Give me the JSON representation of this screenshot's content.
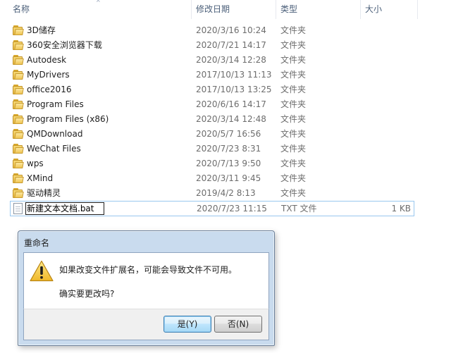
{
  "columns": {
    "name": "名称",
    "date": "修改日期",
    "type": "类型",
    "size": "大小"
  },
  "rows": [
    {
      "name": "3D储存",
      "date": "2020/3/16 10:24",
      "type": "文件夹",
      "size": "",
      "icon": "folder-icon"
    },
    {
      "name": "360安全浏览器下载",
      "date": "2020/7/21 14:17",
      "type": "文件夹",
      "size": "",
      "icon": "folder-icon"
    },
    {
      "name": "Autodesk",
      "date": "2020/3/14 12:28",
      "type": "文件夹",
      "size": "",
      "icon": "folder-icon"
    },
    {
      "name": "MyDrivers",
      "date": "2017/10/13 11:13",
      "type": "文件夹",
      "size": "",
      "icon": "folder-icon"
    },
    {
      "name": "office2016",
      "date": "2017/10/13 13:25",
      "type": "文件夹",
      "size": "",
      "icon": "folder-icon"
    },
    {
      "name": "Program Files",
      "date": "2020/6/16 14:17",
      "type": "文件夹",
      "size": "",
      "icon": "folder-icon"
    },
    {
      "name": "Program Files (x86)",
      "date": "2020/3/14 12:48",
      "type": "文件夹",
      "size": "",
      "icon": "folder-icon"
    },
    {
      "name": "QMDownload",
      "date": "2020/5/7 16:56",
      "type": "文件夹",
      "size": "",
      "icon": "folder-icon"
    },
    {
      "name": "WeChat Files",
      "date": "2020/7/23 8:31",
      "type": "文件夹",
      "size": "",
      "icon": "folder-icon"
    },
    {
      "name": "wps",
      "date": "2020/7/13 9:50",
      "type": "文件夹",
      "size": "",
      "icon": "folder-icon"
    },
    {
      "name": "XMind",
      "date": "2020/3/11 9:45",
      "type": "文件夹",
      "size": "",
      "icon": "folder-icon"
    },
    {
      "name": "驱动精灵",
      "date": "2019/4/2 8:13",
      "type": "文件夹",
      "size": "",
      "icon": "folder-icon"
    }
  ],
  "renaming_row": {
    "name": "新建文本文档.bat",
    "date": "2020/7/23 11:15",
    "type": "TXT 文件",
    "size": "1 KB",
    "icon": "text-file-icon"
  },
  "dialog": {
    "title": "重命名",
    "message": "如果改变文件扩展名，可能会导致文件不可用。",
    "question": "确实要更改吗?",
    "yes_label": "是(Y)",
    "no_label": "否(N)",
    "icon": "warning-icon"
  },
  "colors": {
    "selection_border": "#99c7ee",
    "dialog_frame": "#c9dbee",
    "header_text": "#4c607a"
  }
}
